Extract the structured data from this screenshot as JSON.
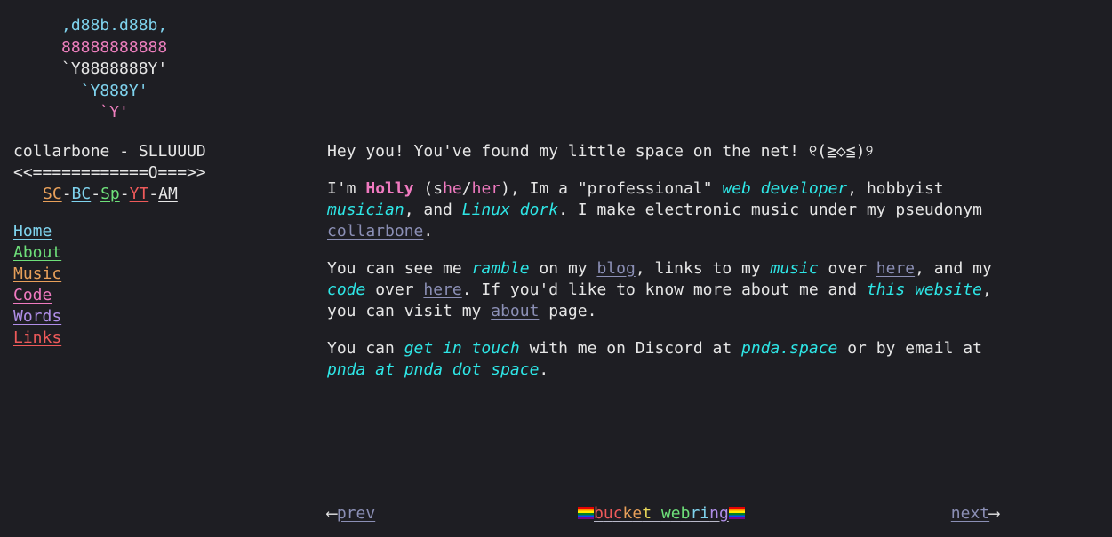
{
  "heart": {
    "line1": ",d88b.d88b,",
    "line2": "88888888888",
    "line3": "`Y8888888Y'",
    "line4": "  `Y888Y'",
    "line5": "    `Y'"
  },
  "sidebar": {
    "title": "collarbone - SLLUUUD",
    "arrow": "<<============O===>>",
    "social": [
      {
        "label": "SC",
        "color": "#e8a05a"
      },
      {
        "label": "BC",
        "color": "#7fd3ee"
      },
      {
        "label": "Sp",
        "color": "#6ee07a"
      },
      {
        "label": "YT",
        "color": "#ee5a5a"
      },
      {
        "label": "AM",
        "color": "#e6e6e6"
      }
    ],
    "social_sep": "-",
    "nav": [
      {
        "label": "Home",
        "color": "#7fd3ee"
      },
      {
        "label": "About",
        "color": "#6ee07a"
      },
      {
        "label": "Music",
        "color": "#e8a05a"
      },
      {
        "label": "Code",
        "color": "#f07ac0"
      },
      {
        "label": "Words",
        "color": "#b08ee8"
      },
      {
        "label": "Links",
        "color": "#ee5a5a"
      }
    ]
  },
  "main": {
    "p1": {
      "text": "Hey you! You've found my little space on the net! ",
      "kaomoji_l": "୧",
      "kaomoji": "(≧◇≦)",
      "kaomoji_r": "୨"
    },
    "p2": {
      "t1": "I'm ",
      "name": "Holly",
      "t2": " (",
      "pn1a": "s",
      "pn1b": "he",
      "slash": "/",
      "pn2": "her",
      "t3": "), Im a \"professional\" ",
      "em1": "web developer",
      "t4": ", hobbyist ",
      "em2": "musician",
      "t5": ", and ",
      "em3": "Linux dork",
      "t6": ". I make electronic music under my pseudonym ",
      "link1": "collarbone",
      "t7": "."
    },
    "p3": {
      "t1": "You can see me ",
      "em1": "ramble",
      "t2": " on my ",
      "link1": "blog",
      "t3": ", links to my ",
      "em2": "music",
      "t4": " over ",
      "link2": "here",
      "t5": ", and my ",
      "em3": "code",
      "t6": " over ",
      "link3": "here",
      "t7": ". If you'd like to know more about me and ",
      "em4": "this website",
      "t8": ", you can visit my ",
      "link4": "about",
      "t9": " page."
    },
    "p4": {
      "t1": "You can ",
      "em1": "get in touch",
      "t2": " with me on Discord at ",
      "em2": "pnda.space",
      "t3": " or by email at ",
      "em3": "pnda at pnda dot space",
      "t4": "."
    }
  },
  "footer": {
    "prev_arrow": "⟵",
    "prev_label": "prev",
    "webring_label": "bucket webring",
    "webring_colors": [
      "#ee5a5a",
      "#e8a05a",
      "#e8d85a",
      "#6ee07a",
      "#7fd3ee",
      "#b08ee8"
    ],
    "next_label": "next",
    "next_arrow": "⟶"
  }
}
